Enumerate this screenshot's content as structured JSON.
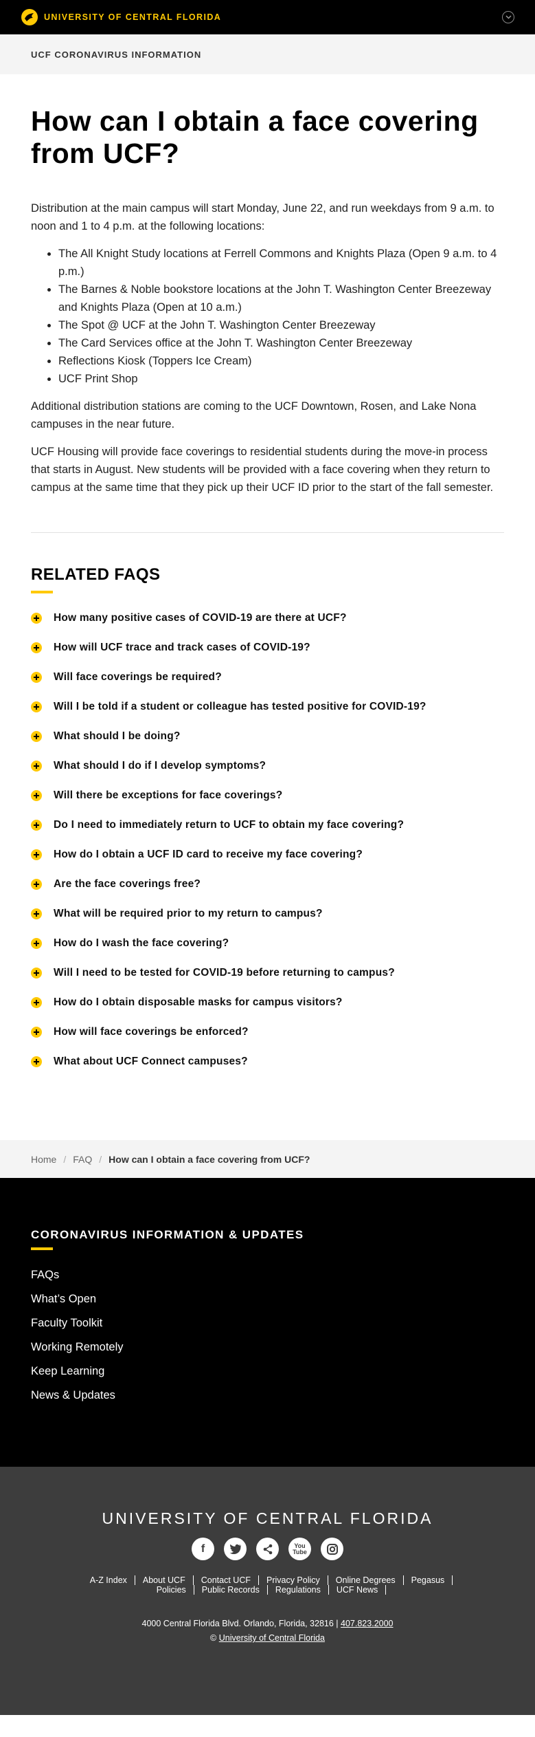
{
  "topbar": {
    "brand": "UNIVERSITY OF CENTRAL FLORIDA"
  },
  "section": {
    "label": "UCF CORONAVIRUS INFORMATION"
  },
  "article": {
    "title": "How can I obtain a face covering from UCF?",
    "intro": "Distribution at the main campus will start Monday, June 22, and run weekdays from 9 a.m. to noon and 1 to 4 p.m. at the following locations:",
    "locations": [
      "The All Knight Study locations at Ferrell Commons and Knights Plaza (Open 9 a.m. to 4 p.m.)",
      "The Barnes & Noble bookstore locations at the John T. Washington Center Breezeway and Knights Plaza (Open at 10 a.m.)",
      "The Spot @ UCF at the John T. Washington Center Breezeway",
      "The Card Services office at the John T. Washington Center Breezeway",
      "Reflections Kiosk (Toppers Ice Cream)",
      "UCF Print Shop"
    ],
    "para2": "Additional distribution stations are coming to the UCF Downtown, Rosen, and Lake Nona campuses in the near future.",
    "para3": "UCF Housing will provide face coverings to residential students during the move-in process that starts in August. New students will be provided with a face covering when they return to campus at the same time that they pick up their UCF ID prior to the start of the fall semester."
  },
  "related": {
    "title": "RELATED FAQS",
    "items": [
      "How many positive cases of COVID-19 are there at UCF?",
      "How will UCF trace and track cases of COVID-19?",
      "Will face coverings be required?",
      "Will I be told if a student or colleague has tested positive for COVID-19?",
      "What should I be doing?",
      "What should I do if I develop symptoms?",
      "Will there be exceptions for face coverings?",
      "Do I need to immediately return to UCF to obtain my face covering?",
      "How do I obtain a UCF ID card to receive my face covering?",
      "Are the face coverings free?",
      "What will be required prior to my return to campus?",
      "How do I wash the face covering?",
      "Will I need to be tested for COVID-19 before returning to campus?",
      "How do I obtain disposable masks for campus visitors?",
      "How will face coverings be enforced?",
      "What about UCF Connect campuses?"
    ]
  },
  "breadcrumb": {
    "home": "Home",
    "faq": "FAQ",
    "current": "How can I obtain a face covering from UCF?"
  },
  "footer_black": {
    "title": "CORONAVIRUS INFORMATION & UPDATES",
    "links": [
      "FAQs",
      "What’s Open",
      "Faculty Toolkit",
      "Working Remotely",
      "Keep Learning",
      "News & Updates"
    ]
  },
  "footer_grey": {
    "title": "UNIVERSITY OF CENTRAL FLORIDA",
    "socials": [
      "facebook-icon",
      "twitter-icon",
      "share-icon",
      "youtube-icon",
      "instagram-icon"
    ],
    "links_row1": [
      "A-Z Index",
      "About UCF",
      "Contact UCF",
      "Privacy Policy",
      "Online Degrees",
      "Pegasus"
    ],
    "links_row2": [
      "Policies",
      "Public Records",
      "Regulations",
      "UCF News"
    ],
    "address": "4000 Central Florida Blvd. Orlando, Florida, 32816 |",
    "phone": "407.823.2000",
    "copyright": "©",
    "copyright_link": "University of Central Florida"
  },
  "colors": {
    "gold": "#ffc904",
    "black": "#000000",
    "footer_grey": "#3d3d3d"
  }
}
